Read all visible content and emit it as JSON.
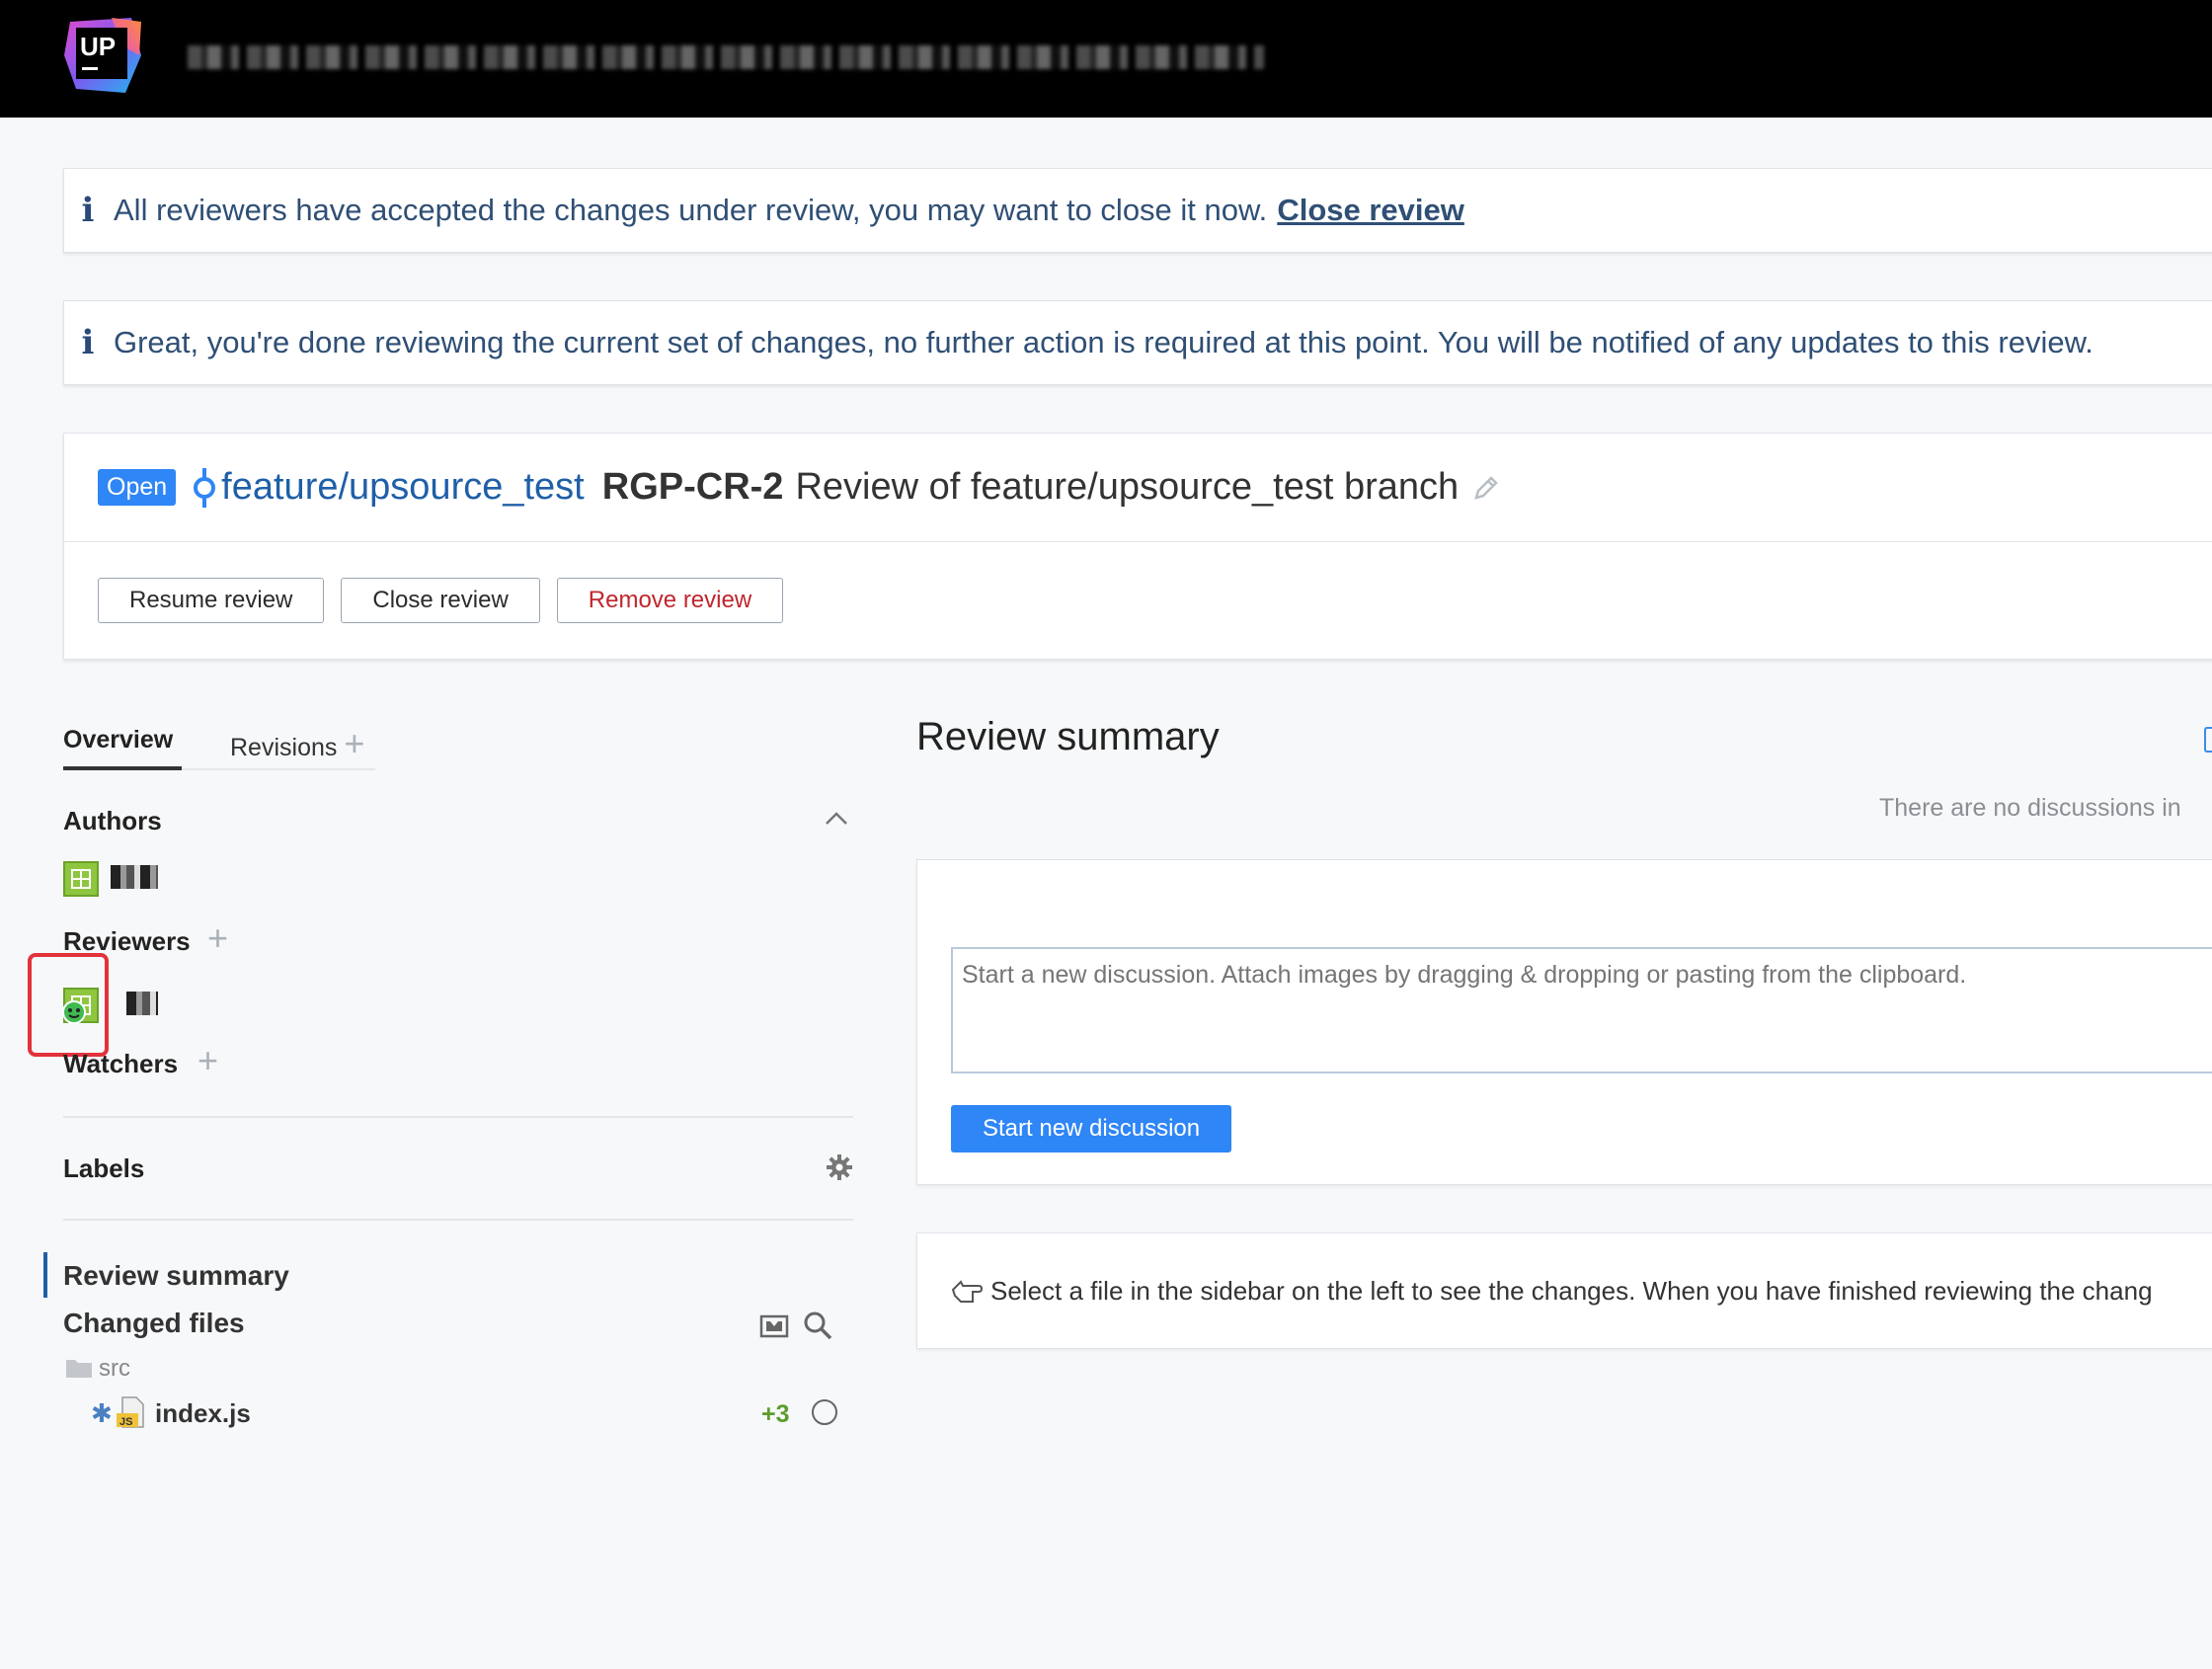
{
  "header": {
    "logo_text": "UP"
  },
  "banners": {
    "accepted": {
      "message": "All reviewers have accepted the changes under review, you may want to close it now.",
      "link": "Close review"
    },
    "done": {
      "message": "Great, you're done reviewing the current set of changes, no further action is required at this point. You will be notified of any updates to this review."
    }
  },
  "review": {
    "status": "Open",
    "branch": "feature/upsource_test",
    "id": "RGP-CR-2",
    "title": "Review of feature/upsource_test branch",
    "buttons": {
      "resume": "Resume review",
      "close": "Close review",
      "remove": "Remove review"
    }
  },
  "sidebar": {
    "tabs": {
      "overview": "Overview",
      "revisions": "Revisions"
    },
    "authors_label": "Authors",
    "reviewers_label": "Reviewers",
    "watchers_label": "Watchers",
    "labels_label": "Labels",
    "nav": {
      "review_summary": "Review summary",
      "changed_files": "Changed files"
    },
    "tree": {
      "folder": "src",
      "file": {
        "marker": "✱",
        "name": "index.js",
        "additions": "+3"
      }
    }
  },
  "main": {
    "title": "Review summary",
    "no_discussions": "There are no discussions in",
    "discussion_placeholder": "Start a new discussion. Attach images by dragging & dropping or pasting from the clipboard.",
    "start_button": "Start new discussion",
    "hint": "Select a file in the sidebar on the left to see the changes. When you have finished reviewing the chang"
  },
  "colors": {
    "accent": "#2f86f6",
    "branch_link": "#1f5fa8",
    "danger": "#c0262d",
    "highlight": "#e2323a",
    "avatar": "#8ec63f",
    "additions": "#5c9c2c"
  }
}
